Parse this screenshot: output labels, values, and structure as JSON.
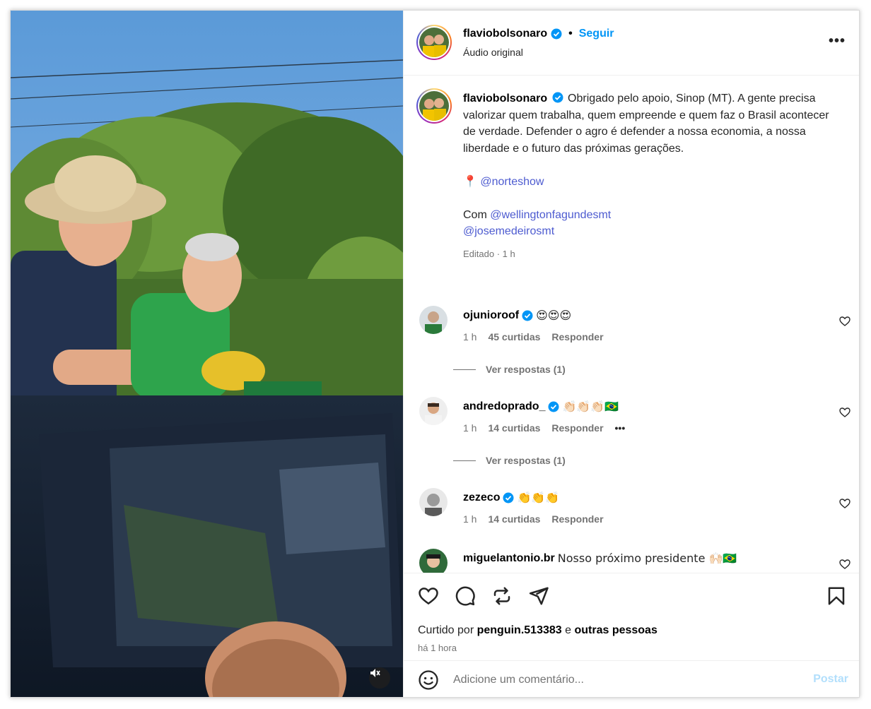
{
  "header": {
    "username": "flaviobolsonaro",
    "separator": "•",
    "follow_label": "Seguir",
    "audio": "Áudio original",
    "more": "•••"
  },
  "caption": {
    "username": "flaviobolsonaro",
    "text": "Obrigado pelo apoio, Sinop (MT). A gente precisa valorizar quem trabalha, quem empreende e quem faz o Brasil acontecer de verdade. Defender o agro é defender a nossa economia, a nossa liberdade e o futuro das próximas gerações.",
    "location_pin": "📍",
    "location_tag": "@norteshow",
    "with_label": "Com",
    "tag1": "@wellingtonfagundesmt",
    "tag2": "@josemedeirosmt",
    "meta": "Editado · 1 h"
  },
  "comments": [
    {
      "username": "ojunioroof",
      "text": "😍😍😍",
      "time": "1 h",
      "likes": "45 curtidas",
      "reply": "Responder",
      "view_replies": "Ver respostas (1)"
    },
    {
      "username": "andredoprado_",
      "text": "👏🏻👏🏻👏🏻🇧🇷",
      "time": "1 h",
      "likes": "14 curtidas",
      "reply": "Responder",
      "more": "•••",
      "view_replies": "Ver respostas (1)"
    },
    {
      "username": "zezeco",
      "text": "👏👏👏",
      "time": "1 h",
      "likes": "14 curtidas",
      "reply": "Responder"
    },
    {
      "username": "miguelantonio.br",
      "text": "Nosso próximo presidente 🙌🏻🇧🇷"
    }
  ],
  "likes": {
    "prefix": "Curtido por",
    "user": "penguin.513383",
    "conj": "e",
    "others": "outras pessoas",
    "time": "há 1 hora"
  },
  "composer": {
    "placeholder": "Adicione um comentário...",
    "post_label": "Postar"
  },
  "colors": {
    "accent": "#0095f6",
    "link": "#4d5bd0",
    "verified": "#0095f6",
    "post_disabled": "#b2dffc"
  }
}
